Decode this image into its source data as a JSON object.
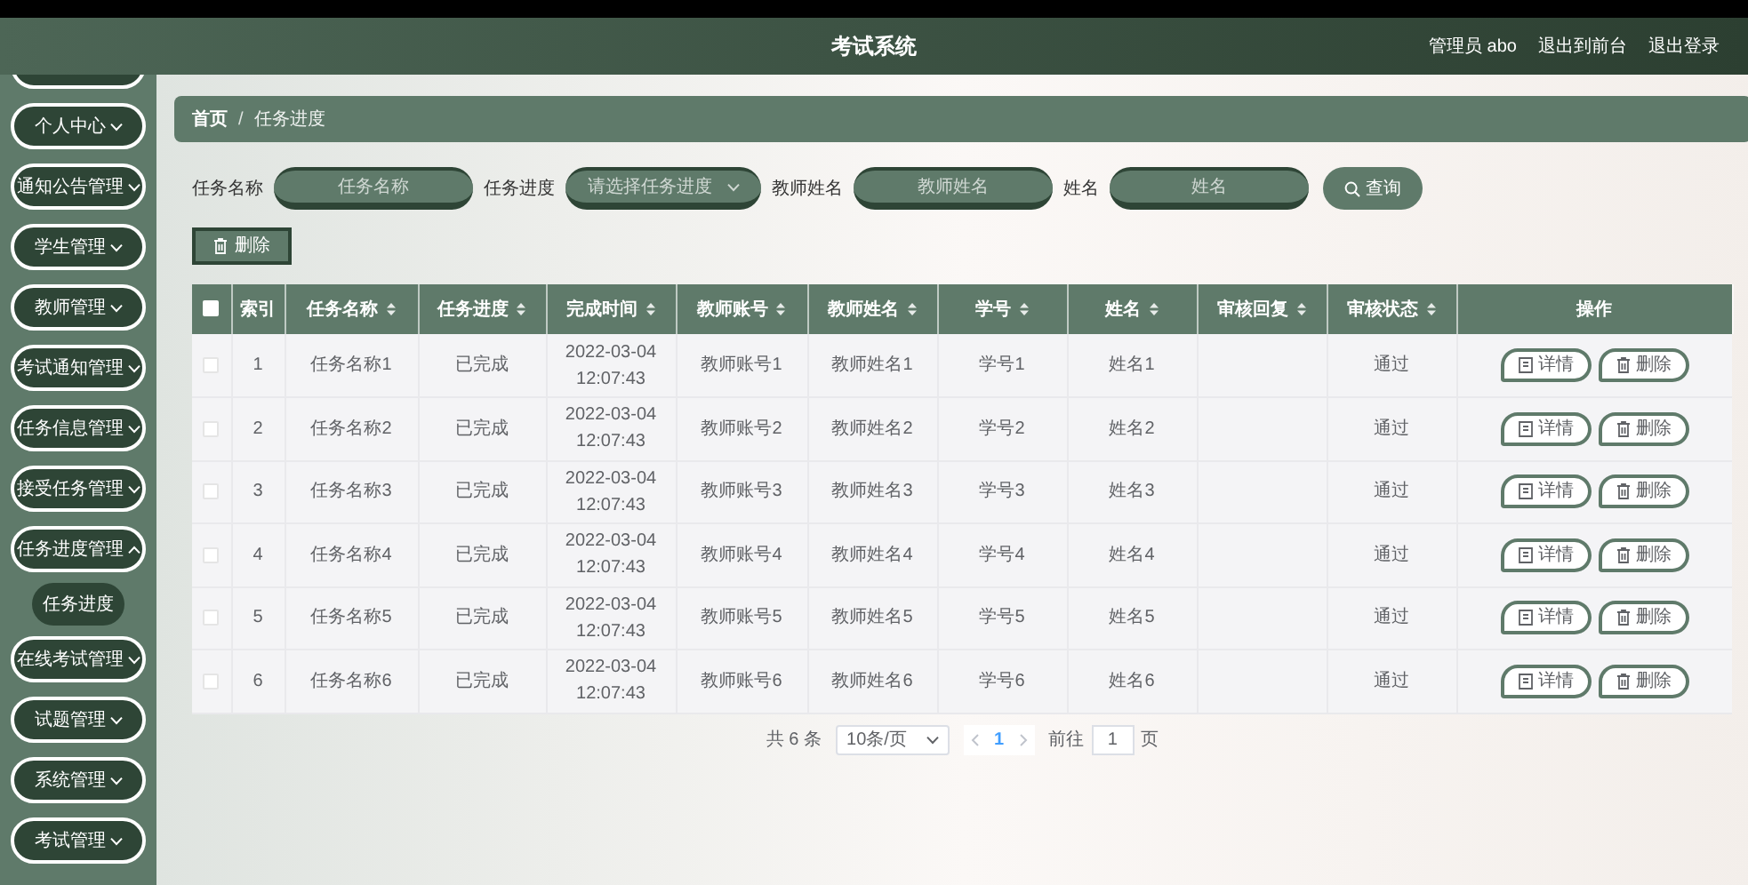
{
  "header": {
    "title": "考试系统",
    "links": [
      "管理员 abo",
      "退出到前台",
      "退出登录"
    ]
  },
  "sidebar": {
    "items": [
      {
        "label": "个人中心",
        "expanded": false
      },
      {
        "label": "通知公告管理",
        "expanded": false
      },
      {
        "label": "学生管理",
        "expanded": false
      },
      {
        "label": "教师管理",
        "expanded": false
      },
      {
        "label": "考试通知管理",
        "expanded": false
      },
      {
        "label": "任务信息管理",
        "expanded": false
      },
      {
        "label": "接受任务管理",
        "expanded": false
      },
      {
        "label": "任务进度管理",
        "expanded": true,
        "children": [
          {
            "label": "任务进度",
            "selected": true
          }
        ]
      },
      {
        "label": "在线考试管理",
        "expanded": false
      },
      {
        "label": "试题管理",
        "expanded": false
      },
      {
        "label": "系统管理",
        "expanded": false
      },
      {
        "label": "考试管理",
        "expanded": false
      }
    ]
  },
  "breadcrumb": {
    "items": [
      "首页",
      "任务进度"
    ],
    "separator": "/"
  },
  "search": {
    "fields": [
      {
        "label": "任务名称",
        "placeholder": "任务名称",
        "kind": "input"
      },
      {
        "label": "任务进度",
        "placeholder": "请选择任务进度",
        "kind": "select"
      },
      {
        "label": "教师姓名",
        "placeholder": "教师姓名",
        "kind": "input"
      },
      {
        "label": "姓名",
        "placeholder": "姓名",
        "kind": "input"
      }
    ],
    "button": "查询"
  },
  "toolbar": {
    "delete_button": "删除"
  },
  "table": {
    "select_all_checked": false,
    "columns": [
      {
        "label": "索引",
        "sortable": false
      },
      {
        "label": "任务名称",
        "sortable": true
      },
      {
        "label": "任务进度",
        "sortable": true
      },
      {
        "label": "完成时间",
        "sortable": true
      },
      {
        "label": "教师账号",
        "sortable": true
      },
      {
        "label": "教师姓名",
        "sortable": true
      },
      {
        "label": "学号",
        "sortable": true
      },
      {
        "label": "姓名",
        "sortable": true
      },
      {
        "label": "审核回复",
        "sortable": true
      },
      {
        "label": "审核状态",
        "sortable": true
      },
      {
        "label": "操作",
        "sortable": false
      }
    ],
    "rows": [
      {
        "checked": false,
        "cells": [
          "1",
          "任务名称1",
          "已完成",
          "2022-03-04 12:07:43",
          "教师账号1",
          "教师姓名1",
          "学号1",
          "姓名1",
          null,
          "通过"
        ],
        "actions": [
          "详情",
          "删除"
        ]
      },
      {
        "checked": false,
        "cells": [
          "2",
          "任务名称2",
          "已完成",
          "2022-03-04 12:07:43",
          "教师账号2",
          "教师姓名2",
          "学号2",
          "姓名2",
          null,
          "通过"
        ],
        "actions": [
          "详情",
          "删除"
        ]
      },
      {
        "checked": false,
        "cells": [
          "3",
          "任务名称3",
          "已完成",
          "2022-03-04 12:07:43",
          "教师账号3",
          "教师姓名3",
          "学号3",
          "姓名3",
          null,
          "通过"
        ],
        "actions": [
          "详情",
          "删除"
        ]
      },
      {
        "checked": false,
        "cells": [
          "4",
          "任务名称4",
          "已完成",
          "2022-03-04 12:07:43",
          "教师账号4",
          "教师姓名4",
          "学号4",
          "姓名4",
          null,
          "通过"
        ],
        "actions": [
          "详情",
          "删除"
        ]
      },
      {
        "checked": false,
        "cells": [
          "5",
          "任务名称5",
          "已完成",
          "2022-03-04 12:07:43",
          "教师账号5",
          "教师姓名5",
          "学号5",
          "姓名5",
          null,
          "通过"
        ],
        "actions": [
          "详情",
          "删除"
        ]
      },
      {
        "checked": false,
        "cells": [
          "6",
          "任务名称6",
          "已完成",
          "2022-03-04 12:07:43",
          "教师账号6",
          "教师姓名6",
          "学号6",
          "姓名6",
          null,
          "通过"
        ],
        "actions": [
          "详情",
          "删除"
        ]
      }
    ]
  },
  "pagination": {
    "total": "共 6 条",
    "page_size": "10条/页",
    "pages": [
      {
        "label": "1",
        "selected": true
      }
    ],
    "goto_label": "前往",
    "goto_value": "1",
    "page_unit": "页"
  }
}
